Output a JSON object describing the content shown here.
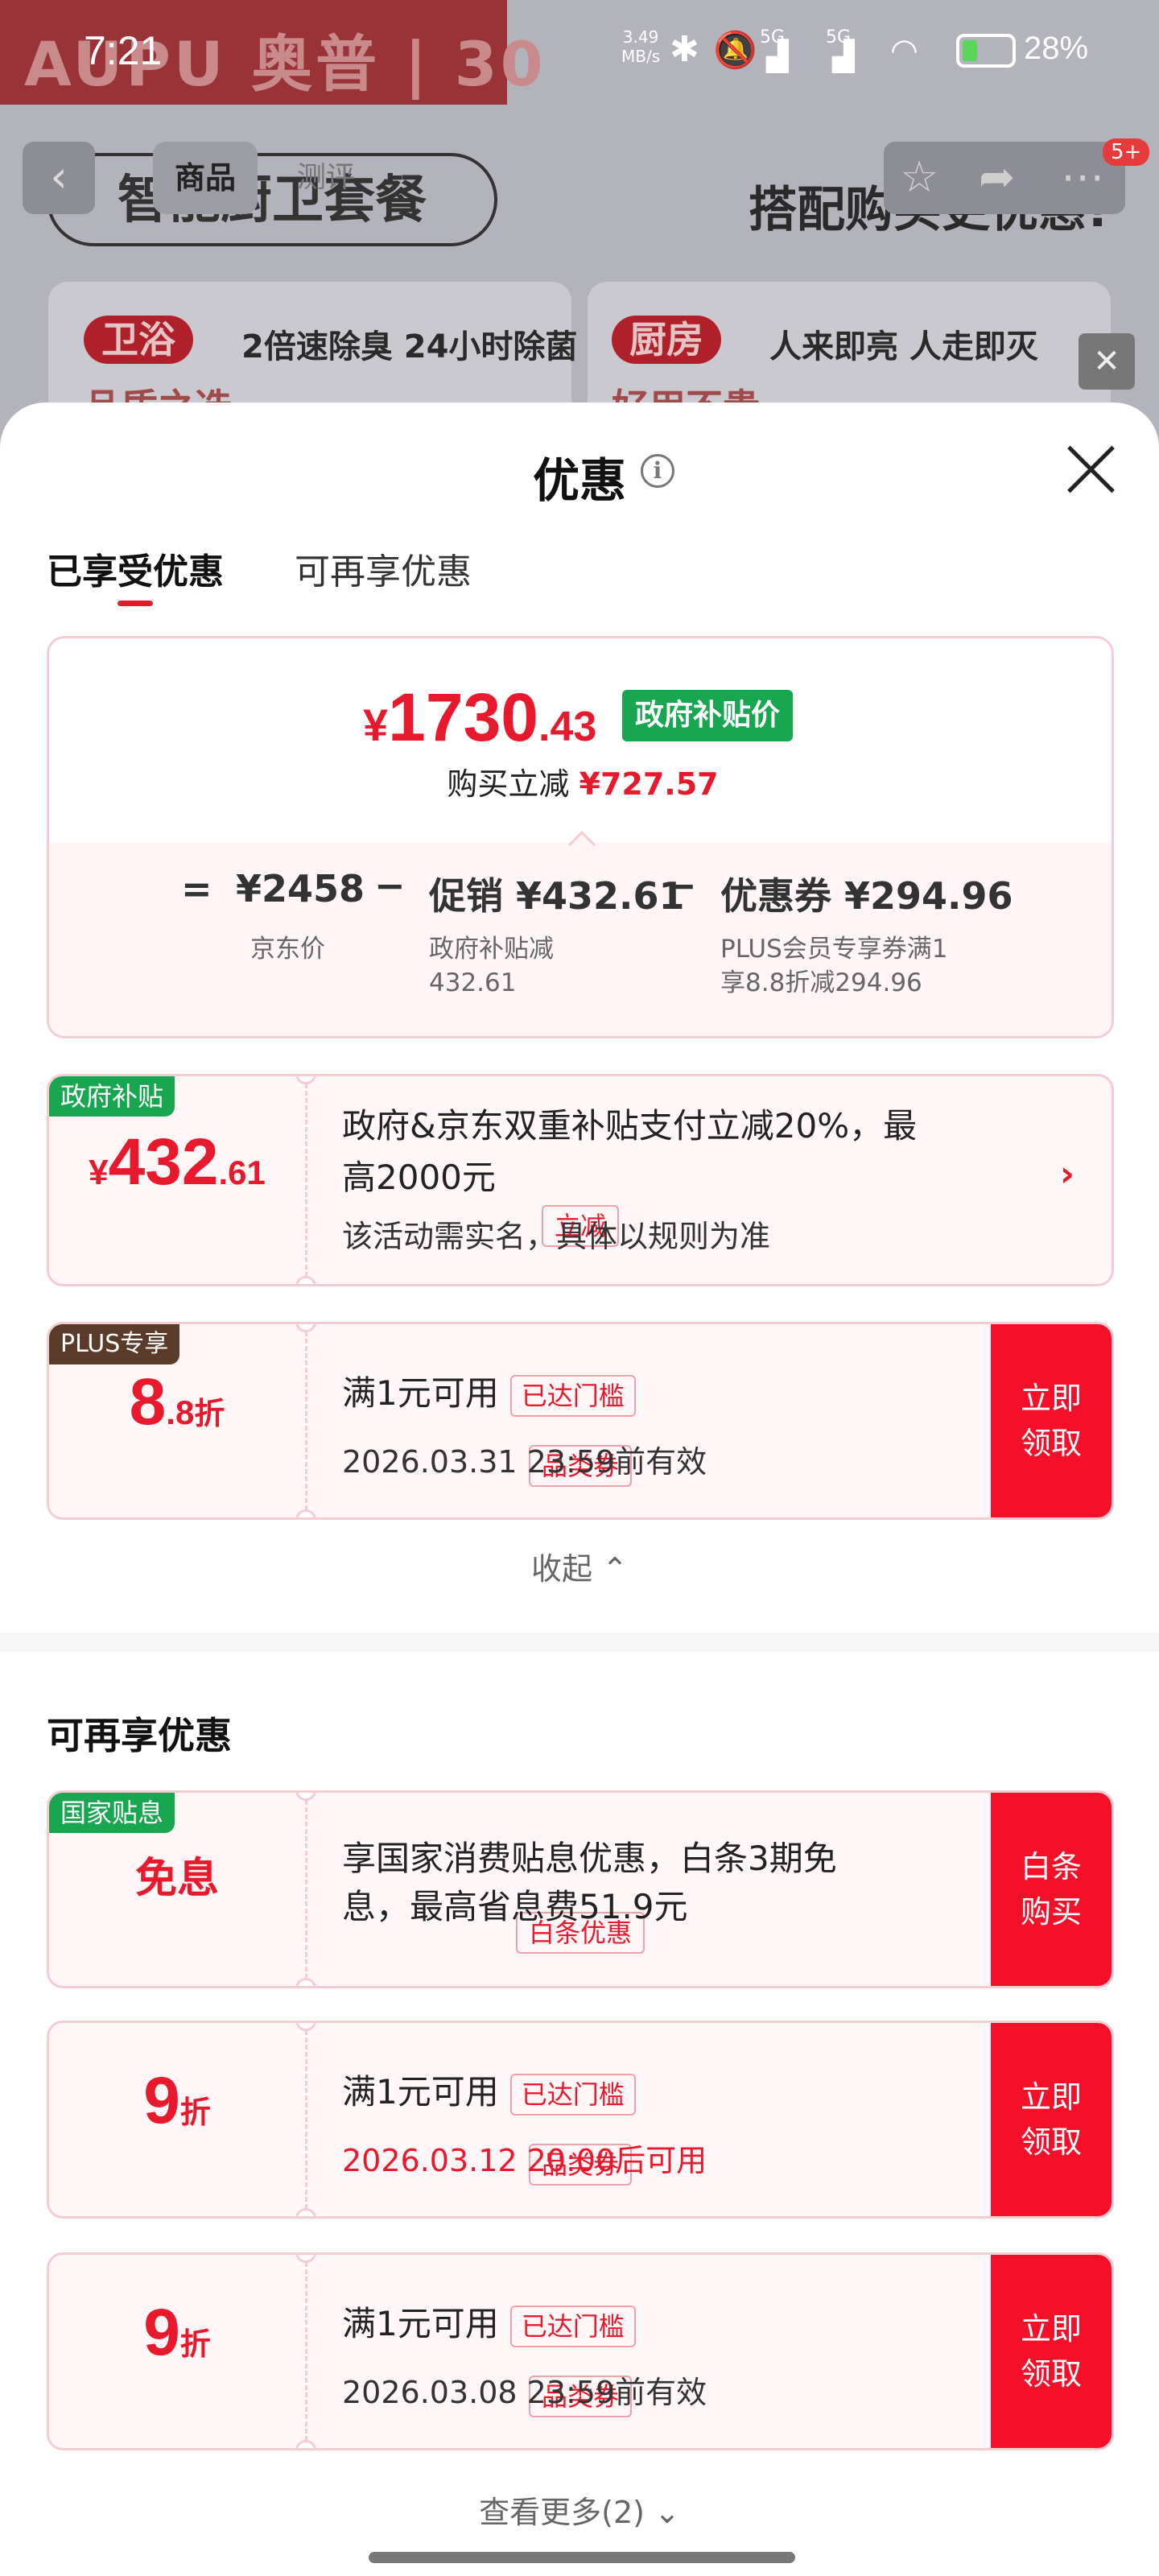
{
  "status_bar": {
    "time": "7:21",
    "net_speed_value": "3.49",
    "net_speed_unit": "MB/s",
    "signal_1": "5G",
    "signal_2": "5G",
    "battery": "28%"
  },
  "background": {
    "brand": "AUPU 奥普 | 30",
    "tabs": [
      "商品",
      "测评"
    ],
    "set_title": "智能厨卫套餐",
    "right_caption": "搭配购买更优惠!",
    "badge": "5+",
    "cards": [
      {
        "tag": "卫浴",
        "text": "2倍速除臭 24小时除菌",
        "sub": "品质之选"
      },
      {
        "tag": "厨房",
        "text": "人来即亮 人走即灭",
        "sub": "好用不贵"
      }
    ]
  },
  "sheet": {
    "title": "优惠",
    "tabs": [
      {
        "label": "已享受优惠",
        "active": true
      },
      {
        "label": "可再享优惠",
        "active": false
      }
    ],
    "summary": {
      "currency": "¥",
      "price_int": "1730",
      "price_dec": ".43",
      "price_tag": "政府补贴价",
      "buy_less_label": "购买立减",
      "buy_less_amount": "¥727.57",
      "formula": {
        "eq": "=",
        "minus": "−",
        "jd_price": "¥2458",
        "jd_price_label": "京东价",
        "promo": "促销 ¥432.61",
        "promo_label_1": "政府补贴减",
        "promo_label_2": "432.61",
        "coupon": "优惠券 ¥294.96",
        "coupon_label_1": "PLUS会员专享券满1",
        "coupon_label_2": "享8.8折减294.96"
      }
    },
    "enjoyed": [
      {
        "corner_tag": "政府补贴",
        "currency": "¥",
        "amount_int": "432",
        "amount_dec": ".61",
        "kind": "立减",
        "title": "政府&京东双重补贴支付立减20%，最",
        "title_2": "高2000元",
        "desc": "该活动需实名，具体以规则为准"
      },
      {
        "corner_tag": "PLUS专享",
        "amount_int": "8",
        "amount_dec": ".8",
        "amount_unit": "折",
        "kind": "品类券",
        "title": "满1元可用",
        "reached": "已达门槛",
        "desc": "2026.03.31 23:59前有效",
        "action": "立即\n领取"
      }
    ],
    "collapse_label": "收起 ⌃",
    "more_section_title": "可再享优惠",
    "more": [
      {
        "corner_tag": "国家贴息",
        "amount_text": "免息",
        "kind": "白条优惠",
        "title": "享国家消费贴息优惠，白条3期免",
        "title_2": "息，最高省息费51.9元",
        "action": "白条\n购买"
      },
      {
        "amount_int": "9",
        "amount_unit": "折",
        "kind": "品类券",
        "title": "满1元可用",
        "reached": "已达门槛",
        "desc": "2026.03.12 20:00后可用",
        "action": "立即\n领取"
      },
      {
        "amount_int": "9",
        "amount_unit": "折",
        "kind": "品类券",
        "title": "满1元可用",
        "reached": "已达门槛",
        "desc": "2026.03.08 23:59前有效",
        "action": "立即\n领取"
      }
    ],
    "see_more_label": "查看更多(2) ⌄"
  },
  "colors": {
    "accent_red": "#e8192c",
    "action_red": "#f5102a",
    "gov_green": "#19a650",
    "plus_brown": "#5a3a28",
    "border_pink": "#f4cdd3"
  }
}
